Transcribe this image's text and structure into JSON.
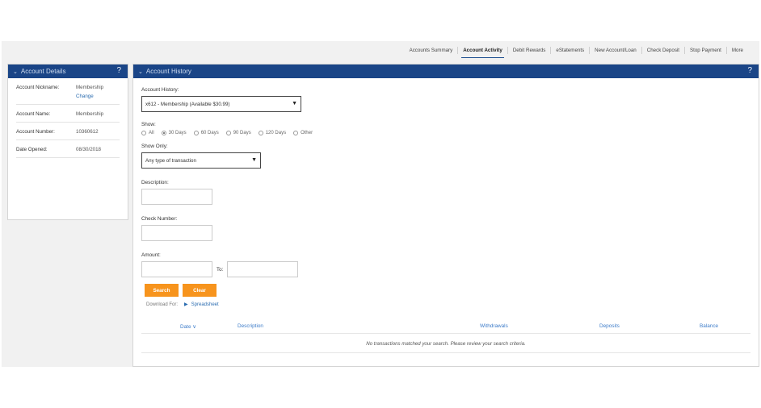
{
  "nav": {
    "items": [
      {
        "label": "Accounts Summary",
        "active": false
      },
      {
        "label": "Account Activity",
        "active": true
      },
      {
        "label": "Debit Rewards",
        "active": false
      },
      {
        "label": "eStatements",
        "active": false
      },
      {
        "label": "New Account/Loan",
        "active": false
      },
      {
        "label": "Check Deposit",
        "active": false
      },
      {
        "label": "Stop Payment",
        "active": false
      },
      {
        "label": "More",
        "active": false
      }
    ]
  },
  "details": {
    "title": "Account Details",
    "help": "?",
    "rows": [
      {
        "label": "Account Nickname:",
        "value": "Membership",
        "link": "Change"
      },
      {
        "label": "Account Name:",
        "value": "Membership"
      },
      {
        "label": "Account Number:",
        "value": "10360612"
      },
      {
        "label": "Date Opened:",
        "value": "08/30/2018"
      }
    ]
  },
  "history": {
    "title": "Account History",
    "help": "?",
    "account_label": "Account History:",
    "account_value": "x612 - Membership (Available $30.99)",
    "show_label": "Show:",
    "show_options": [
      "All",
      "30 Days",
      "60 Days",
      "90 Days",
      "120 Days",
      "Other"
    ],
    "show_selected": "30 Days",
    "show_only_label": "Show Only:",
    "show_only_value": "Any type of transaction",
    "description_label": "Description:",
    "check_number_label": "Check Number:",
    "amount_label": "Amount:",
    "to_label": "To:",
    "search_label": "Search",
    "clear_label": "Clear",
    "download_label": "Download For:",
    "spreadsheet_label": "Spreadsheet",
    "columns": {
      "date": "Date ∨",
      "description": "Description",
      "withdrawals": "Withdrawals",
      "deposits": "Deposits",
      "balance": "Balance"
    },
    "empty_message": "No transactions matched your search. Please review your search criteria."
  },
  "colors": {
    "header_blue": "#1a4587",
    "button_orange": "#f7941d",
    "link_blue": "#2b6cb0"
  }
}
